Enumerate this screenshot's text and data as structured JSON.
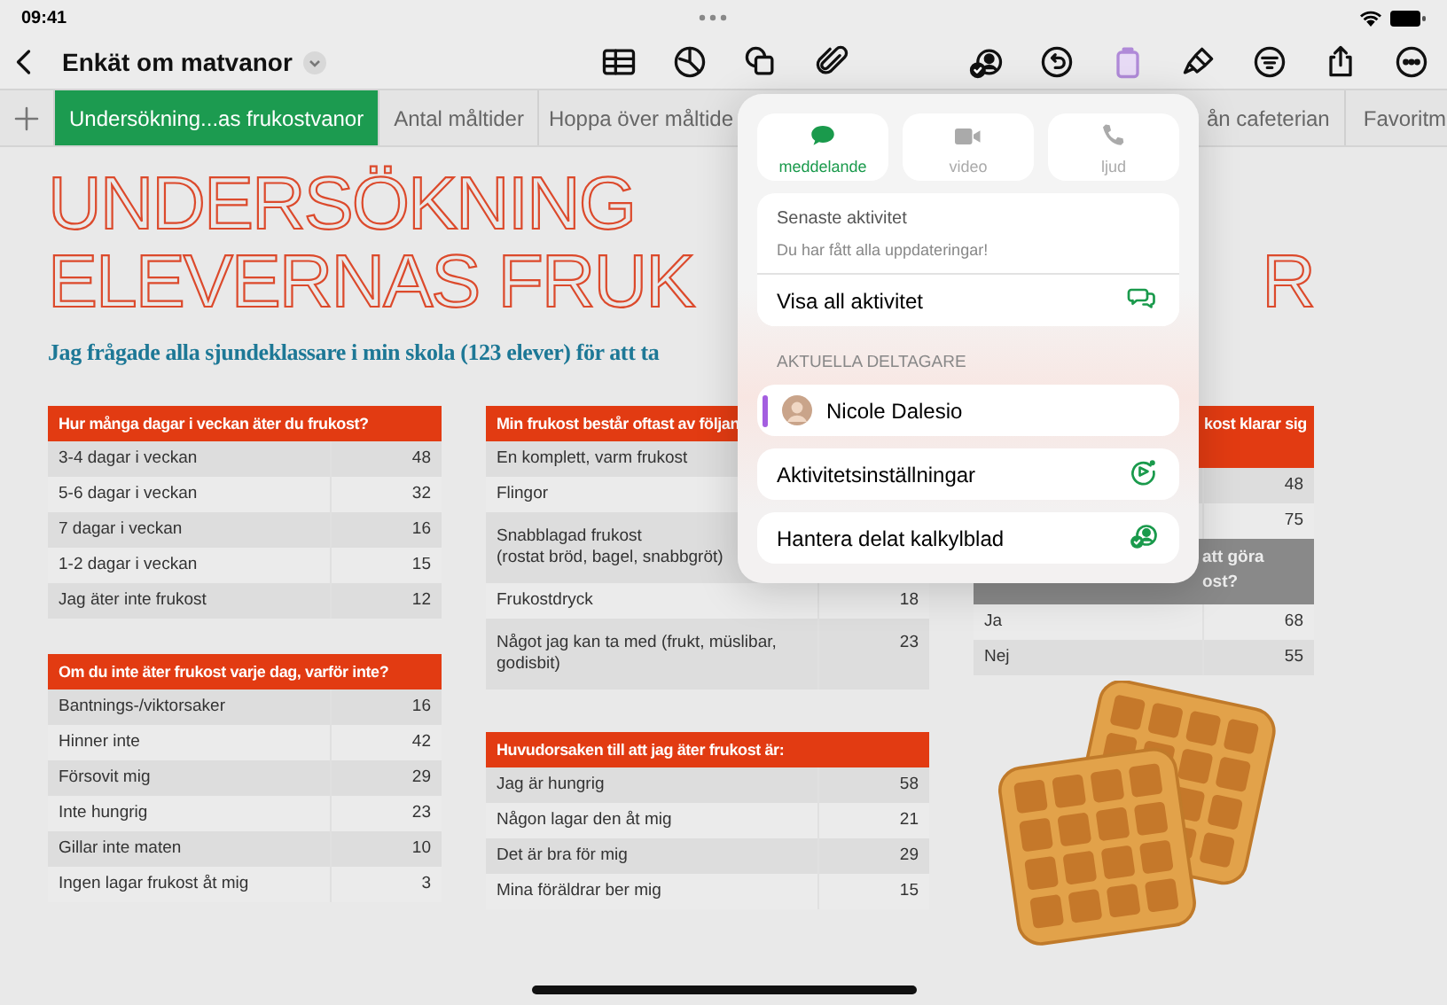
{
  "status_bar": {
    "time": "09:41"
  },
  "toolbar": {
    "title": "Enkät om matvanor"
  },
  "sheet_tabs": [
    {
      "label": "Undersökning...as frukostvanor",
      "selected": true
    },
    {
      "label": "Antal måltider",
      "selected": false
    },
    {
      "label": "Hoppa över måltide",
      "selected": false
    },
    {
      "label": "ån cafeterian",
      "selected": false
    },
    {
      "label": "Favoritm",
      "selected": false
    }
  ],
  "sheet": {
    "title_lines": [
      "UNDERSÖKNING",
      "ELEVERNAS FRUK"
    ],
    "title_tail": "R",
    "subtitle": "Jag frågade alla sjundeklassare i min skola (123 elever) för att ta",
    "columns": [
      [
        {
          "header": "Hur många dagar i veckan äter du frukost?",
          "rows": [
            {
              "kind": "row",
              "label": "3-4 dagar i veckan",
              "value": "48"
            },
            {
              "kind": "row",
              "label": "5-6 dagar i veckan",
              "value": "32"
            },
            {
              "kind": "row",
              "label": "7 dagar i veckan",
              "value": "16"
            },
            {
              "kind": "row",
              "label": "1-2 dagar i veckan",
              "value": "15"
            },
            {
              "kind": "row",
              "label": "Jag äter inte frukost",
              "value": "12"
            }
          ]
        },
        {
          "header": "Om du inte äter frukost varje dag, varför inte?",
          "rows": [
            {
              "kind": "row",
              "label": "Bantnings-/viktorsaker",
              "value": "16"
            },
            {
              "kind": "row",
              "label": "Hinner inte",
              "value": "42"
            },
            {
              "kind": "row",
              "label": "Försovit mig",
              "value": "29"
            },
            {
              "kind": "row",
              "label": "Inte hungrig",
              "value": "23"
            },
            {
              "kind": "row",
              "label": "Gillar inte maten",
              "value": "10"
            },
            {
              "kind": "row",
              "label": "Ingen lagar frukost åt mig",
              "value": "3"
            }
          ]
        }
      ],
      [
        {
          "header": "Min frukost består oftast av följan",
          "rows": [
            {
              "kind": "row",
              "label": "En komplett, varm frukost"
            },
            {
              "kind": "row",
              "label": "Flingor"
            },
            {
              "kind": "row",
              "label": "Snabblagad frukost\n(rostat bröd, bagel, snabbgröt)"
            },
            {
              "kind": "row",
              "label": "Frukostdryck",
              "value": "18"
            },
            {
              "kind": "row",
              "label": "Något jag kan ta med (frukt, müslibar,\ngodisbit)",
              "value": "23"
            }
          ]
        },
        {
          "header": "Huvudorsaken till att jag äter frukost är:",
          "rows": [
            {
              "kind": "row",
              "label": "Jag är hungrig",
              "value": "58"
            },
            {
              "kind": "row",
              "label": "Någon lagar den åt mig",
              "value": "21"
            },
            {
              "kind": "row",
              "label": "Det är bra för mig",
              "value": "29"
            },
            {
              "kind": "row",
              "label": "Mina föräldrar ber mig",
              "value": "15"
            }
          ]
        }
      ],
      [
        {
          "header": "kost klarar sig",
          "rows": [
            {
              "kind": "row",
              "value": "48"
            },
            {
              "kind": "row",
              "value": "75"
            },
            {
              "kind": "subheader",
              "label": "att göra ost?"
            },
            {
              "kind": "row",
              "label": "Ja",
              "value": "68"
            },
            {
              "kind": "row",
              "label": "Nej",
              "value": "55"
            }
          ]
        }
      ]
    ]
  },
  "popover": {
    "actions": [
      {
        "kind": "message",
        "label": "meddelande",
        "selected": true
      },
      {
        "kind": "video",
        "label": "video",
        "selected": false
      },
      {
        "kind": "audio",
        "label": "ljud",
        "selected": false
      }
    ],
    "activity": {
      "title": "Senaste aktivitet",
      "status": "Du har fått alla uppdateringar!",
      "link": "Visa all aktivitet"
    },
    "participants_heading": "AKTUELLA DELTAGARE",
    "participants": [
      {
        "name": "Nicole Dalesio",
        "color": "#a45ee0"
      }
    ],
    "options": [
      {
        "kind": "activity-settings",
        "label": "Aktivitetsinställningar"
      },
      {
        "kind": "manage-sharing",
        "label": "Hantera delat kalkylblad"
      }
    ]
  }
}
